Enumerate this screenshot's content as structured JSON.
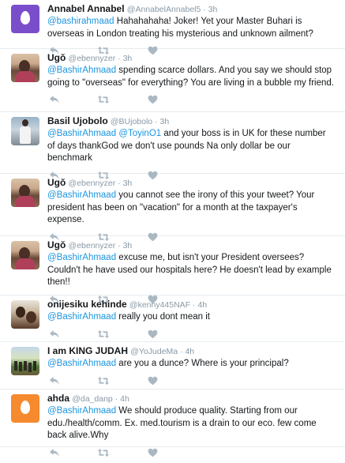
{
  "tweets": [
    {
      "id": "t1",
      "avatar": "egg-purple",
      "name": "Annabel Annabel",
      "handle": "@AnnabelAnnabel5",
      "time": "3h",
      "mentions": [
        "@bashirahmaad"
      ],
      "text": " Hahahahaha! Joker! Yet your Master Buhari is overseas in London treating his mysterious and unknown ailment?"
    },
    {
      "id": "t2",
      "avatar": "photo-ugo",
      "name": "Ugŏ",
      "handle": "@ebennyzer",
      "time": "3h",
      "mentions": [
        "@BashirAhmaad"
      ],
      "text": " spending scarce dollars. And you say we should stop going to \"overseas\" for everything? You are living in a bubble my friend."
    },
    {
      "id": "t3",
      "avatar": "photo-basil",
      "name": "Basil Ujobolo",
      "handle": "@BUjobolo",
      "time": "3h",
      "mentions": [
        "@BashirAhmaad",
        "@ToyinO1"
      ],
      "text": " and your boss is in UK for these number of days thankGod we don't use pounds Na only dollar be our benchmark"
    },
    {
      "id": "t4",
      "avatar": "photo-ugo",
      "name": "Ugŏ",
      "handle": "@ebennyzer",
      "time": "3h",
      "mentions": [
        "@BashirAhmaad"
      ],
      "text": " you cannot see the irony of this your tweet? Your president has been on \"vacation\" for a month at the taxpayer's expense."
    },
    {
      "id": "t5",
      "avatar": "photo-ugo",
      "name": "Ugŏ",
      "handle": "@ebennyzer",
      "time": "3h",
      "mentions": [
        "@BashirAhmaad"
      ],
      "text": " excuse me, but isn't your President oversees? Couldn't he have used our hospitals here? He doesn't lead by example then!!"
    },
    {
      "id": "t6",
      "avatar": "photo-oni",
      "name": "onijesiku kehinde",
      "handle": "@kenny445NAF",
      "time": "4h",
      "mentions": [
        "@BashirAhmaad"
      ],
      "text": " really you dont mean it"
    },
    {
      "id": "t7",
      "avatar": "photo-judah",
      "name": "I am KING JUDAH",
      "handle": "@YoJudeMa",
      "time": "4h",
      "mentions": [
        "@BashirAhmaad"
      ],
      "text": " are you a dunce? Where is your principal?"
    },
    {
      "id": "t8",
      "avatar": "egg-orange",
      "name": "ahda",
      "handle": "@da_danp",
      "time": "4h",
      "mentions": [
        "@BashirAhmaad"
      ],
      "text": " We should produce quality. Starting from our edu./health/comm. Ex. med.tourism is a drain to our eco. few come back alive.Why"
    }
  ],
  "separator": "·",
  "colors": {
    "mention": "#1b95e0",
    "meta": "#8899a6",
    "icon": "#aab8c2",
    "divider": "#e6ecf0"
  },
  "icons": [
    "reply-icon",
    "retweet-icon",
    "like-icon"
  ]
}
